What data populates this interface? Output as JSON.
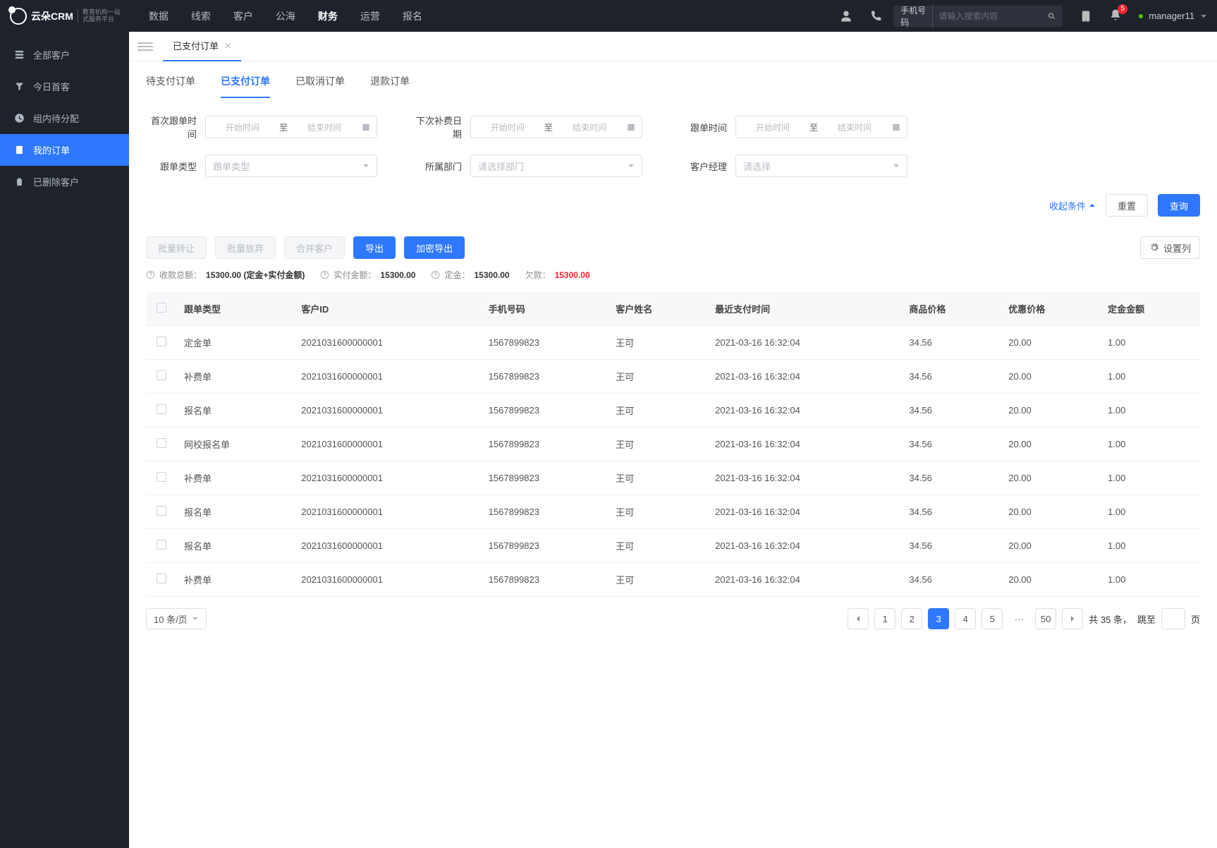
{
  "header": {
    "logo_text": "云朵CRM",
    "logo_sub1": "教育机构一站",
    "logo_sub2": "式服务平台",
    "menu": [
      "数据",
      "线索",
      "客户",
      "公海",
      "财务",
      "运营",
      "报名"
    ],
    "active_menu": 4,
    "search_type": "手机号码",
    "search_placeholder": "请输入搜索内容",
    "notif_badge": "5",
    "user": "manager11"
  },
  "sidebar": {
    "items": [
      {
        "icon": "users",
        "label": "全部客户"
      },
      {
        "icon": "filter",
        "label": "今日首客"
      },
      {
        "icon": "clock",
        "label": "组内待分配"
      },
      {
        "icon": "order",
        "label": "我的订单"
      },
      {
        "icon": "trash",
        "label": "已删除客户"
      }
    ],
    "active": 3
  },
  "page_tab": {
    "label": "已支付订单"
  },
  "sub_tabs": [
    "待支付订单",
    "已支付订单",
    "已取消订单",
    "退款订单"
  ],
  "sub_tab_active": 1,
  "filters": {
    "row1": [
      {
        "label": "首次跟单时间",
        "type": "range",
        "start": "开始时间",
        "to": "至",
        "end": "结束时间"
      },
      {
        "label": "下次补费日期",
        "type": "range",
        "start": "开始时间",
        "to": "至",
        "end": "结束时间"
      },
      {
        "label": "跟单时间",
        "type": "range",
        "start": "开始时间",
        "to": "至",
        "end": "结束时间"
      }
    ],
    "row2": [
      {
        "label": "跟单类型",
        "type": "select",
        "placeholder": "跟单类型"
      },
      {
        "label": "所属部门",
        "type": "select",
        "placeholder": "请选择部门"
      },
      {
        "label": "客户经理",
        "type": "select",
        "placeholder": "请选择"
      }
    ],
    "collapse": "收起条件",
    "reset": "重置",
    "query": "查询"
  },
  "toolbar": {
    "batch_transfer": "批量转让",
    "batch_abandon": "批量放弃",
    "merge": "合并客户",
    "export": "导出",
    "encrypt_export": "加密导出",
    "col_setting": "设置列"
  },
  "summary": {
    "total_receipt_label": "收款总额：",
    "total_receipt_val": "15300.00 (定金+实付金额)",
    "actual_label": "实付金额：",
    "actual_val": "15300.00",
    "deposit_label": "定金：",
    "deposit_val": "15300.00",
    "debt_label": "欠款：",
    "debt_val": "15300.00"
  },
  "table": {
    "cols": [
      "跟单类型",
      "客户ID",
      "手机号码",
      "客户姓名",
      "最近支付时间",
      "商品价格",
      "优惠价格",
      "定金金额"
    ],
    "rows": [
      [
        "定金单",
        "2021031600000001",
        "1567899823",
        "王可",
        "2021-03-16 16:32:04",
        "34.56",
        "20.00",
        "1.00"
      ],
      [
        "补费单",
        "2021031600000001",
        "1567899823",
        "王可",
        "2021-03-16 16:32:04",
        "34.56",
        "20.00",
        "1.00"
      ],
      [
        "报名单",
        "2021031600000001",
        "1567899823",
        "王可",
        "2021-03-16 16:32:04",
        "34.56",
        "20.00",
        "1.00"
      ],
      [
        "网校报名单",
        "2021031600000001",
        "1567899823",
        "王可",
        "2021-03-16 16:32:04",
        "34.56",
        "20.00",
        "1.00"
      ],
      [
        "补费单",
        "2021031600000001",
        "1567899823",
        "王可",
        "2021-03-16 16:32:04",
        "34.56",
        "20.00",
        "1.00"
      ],
      [
        "报名单",
        "2021031600000001",
        "1567899823",
        "王可",
        "2021-03-16 16:32:04",
        "34.56",
        "20.00",
        "1.00"
      ],
      [
        "报名单",
        "2021031600000001",
        "1567899823",
        "王可",
        "2021-03-16 16:32:04",
        "34.56",
        "20.00",
        "1.00"
      ],
      [
        "补费单",
        "2021031600000001",
        "1567899823",
        "王可",
        "2021-03-16 16:32:04",
        "34.56",
        "20.00",
        "1.00"
      ]
    ]
  },
  "pagination": {
    "page_size": "10 条/页",
    "pages": [
      "1",
      "2",
      "3",
      "4",
      "5"
    ],
    "active": 2,
    "last": "50",
    "ellipsis": "···",
    "total_prefix": "共 ",
    "total": "35",
    "total_suffix": " 条，",
    "jump_label": "跳至",
    "page_unit": "页"
  }
}
